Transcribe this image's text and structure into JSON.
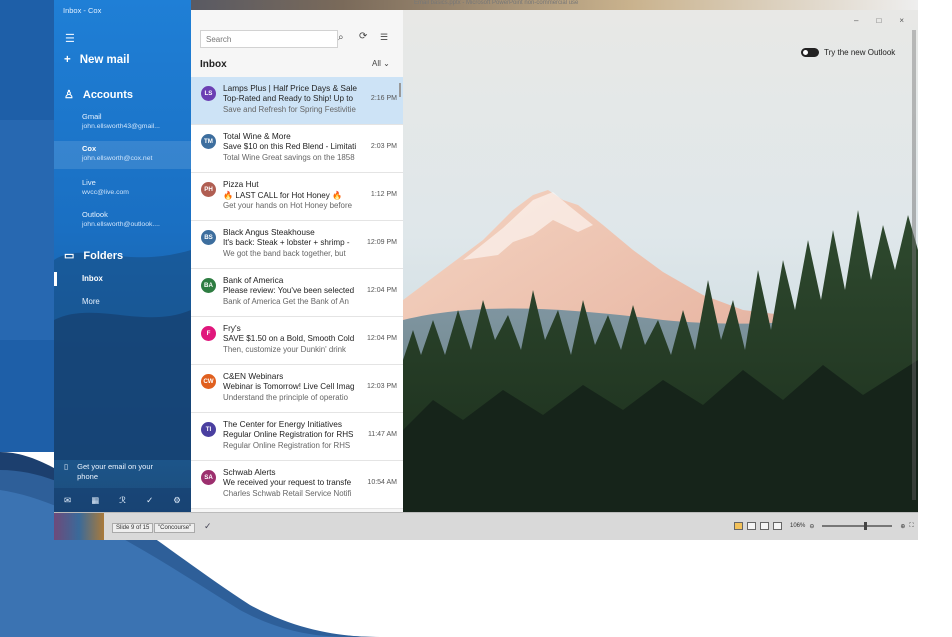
{
  "window": {
    "title": "Inbox - Cox",
    "desktop_title": "Email basics.pptx - Microsoft PowerPoint non-commercial use"
  },
  "sidebar": {
    "new_mail": "New mail",
    "accounts_label": "Accounts",
    "accounts": [
      {
        "name": "Gmail",
        "email": "john.ellsworth43@gmail..."
      },
      {
        "name": "Cox",
        "email": "john.ellsworth@cox.net"
      },
      {
        "name": "Live",
        "email": "wvcc@live.com"
      },
      {
        "name": "Outlook",
        "email": "john.ellsworth@outlook...."
      }
    ],
    "folders_label": "Folders",
    "folders": [
      "Inbox",
      "More"
    ],
    "get_email_line1": "Get your email on your",
    "get_email_line2": "phone"
  },
  "list": {
    "search_placeholder": "Search",
    "title": "Inbox",
    "filter": "All",
    "messages": [
      {
        "initials": "LS",
        "color": "#6b3fb3",
        "sender": "Lamps Plus | Half Price Days & Sale",
        "subject": "Top-Rated and Ready to Ship! Up to",
        "time": "2:16 PM",
        "preview": "Save and Refresh for Spring Festivitie"
      },
      {
        "initials": "TM",
        "color": "#3d6e9e",
        "sender": "Total Wine & More",
        "subject": "Save $10 on this Red Blend - Limitati",
        "time": "2:03 PM",
        "preview": "Total Wine Great savings on the 1858"
      },
      {
        "initials": "PH",
        "color": "#b05e52",
        "sender": "Pizza Hut",
        "subject": "🔥 LAST CALL for Hot Honey 🔥",
        "time": "1:12 PM",
        "preview": "Get your hands on Hot Honey before"
      },
      {
        "initials": "BS",
        "color": "#3d6e9e",
        "sender": "Black Angus Steakhouse",
        "subject": "It's back: Steak + lobster + shrimp -",
        "time": "12:09 PM",
        "preview": "We got the band back together, but"
      },
      {
        "initials": "BA",
        "color": "#2e7d42",
        "sender": "Bank of America",
        "subject": "Please review: You've been selected",
        "time": "12:04 PM",
        "preview": "Bank of America Get the Bank of An"
      },
      {
        "initials": "F",
        "color": "#e0177c",
        "sender": "Fry's",
        "subject": "SAVE $1.50 on a Bold, Smooth Cold",
        "time": "12:04 PM",
        "preview": "Then, customize your Dunkin' drink"
      },
      {
        "initials": "CW",
        "color": "#e0601f",
        "sender": "C&EN Webinars",
        "subject": "Webinar is Tomorrow! Live Cell Imag",
        "time": "12:03 PM",
        "preview": "Understand the principle of operatio"
      },
      {
        "initials": "TI",
        "color": "#4a3fa0",
        "sender": "The Center for Energy Initiatives",
        "subject": "Regular Online Registration for RHS",
        "time": "11:47 AM",
        "preview": "Regular Online Registration for RHS"
      },
      {
        "initials": "SA",
        "color": "#9c2f6e",
        "sender": "Schwab Alerts",
        "subject": "We received your request to transfe",
        "time": "10:54 AM",
        "preview": "Charles Schwab Retail Service Notifi"
      }
    ]
  },
  "pane": {
    "try_new_outlook": "Try the new Outlook",
    "min": "–",
    "max": "□",
    "close": "×"
  },
  "statusbar": {
    "slide_info": "Slide 9 of 15",
    "theme": "\"Concourse\"",
    "zoom": "106%"
  }
}
